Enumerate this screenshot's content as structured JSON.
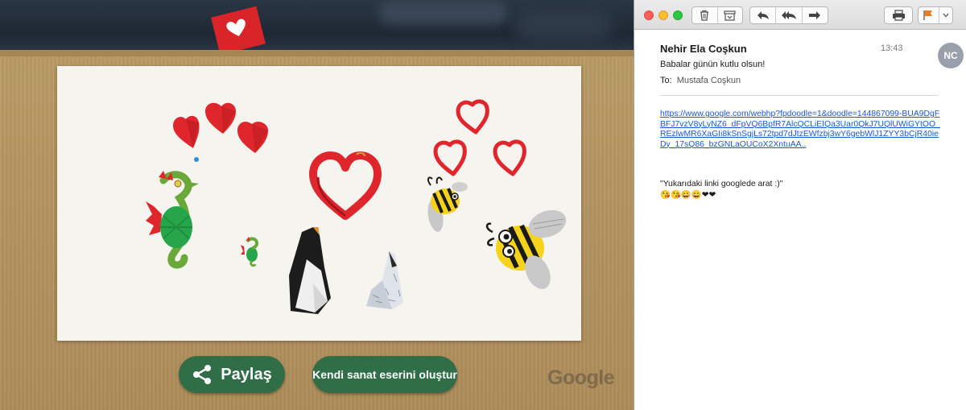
{
  "doodle": {
    "share_label": "Paylaş",
    "create_label": "Kendi sanat eserini oluştur",
    "logo_text": "Google"
  },
  "mail": {
    "sender_name": "Nehir Ela Coşkun",
    "time": "13:43",
    "avatar_initials": "NC",
    "subject": "Babalar günün kutlu olsun!",
    "to_label": "To:",
    "to_value": "Mustafa Coşkun",
    "link": "https://www.google.com/webhp?fpdoodle=1&doodle=144867099-BUA9DgFBFJ7vzV8yLyNZ6_dFpVQ6BpfR7AlcQCLiEIQa3Uar0QkJ7UQlUWiGYtOO_REzlwMR6XaGIi8kSnSgjLs72tpd7dJtzEWfzbj3wY6gebWlJ1ZYY3bCjR40ieDy_17sQ86_bzGNLaOUCoX2XntuAA..",
    "quote": "\"Yukarıdaki linki googlede arat :)\"",
    "emoji_line": "😘😘😀😀❤❤"
  },
  "colors": {
    "button_green": "#2f6e47",
    "heart_red": "#e0262d",
    "link_blue": "#1b56d6",
    "flag_orange": "#f07a1e"
  },
  "icons": [
    "trash-icon",
    "archive-icon",
    "reply-icon",
    "reply-all-icon",
    "forward-icon",
    "print-icon",
    "flag-icon",
    "chevron-down-icon",
    "share-icon"
  ]
}
